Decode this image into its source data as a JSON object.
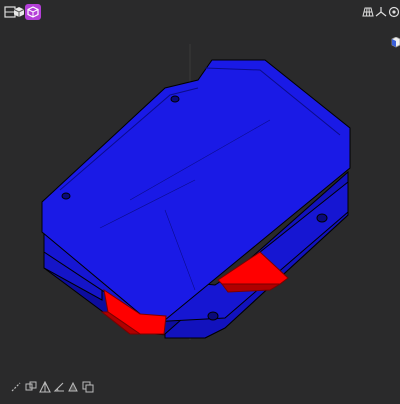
{
  "viewport": {
    "background": "#2a2a2b",
    "model": {
      "color": "#1a1ae6",
      "highlight_color": "#ff0000",
      "edge_color": "#000000"
    }
  },
  "toolbar_top_left": {
    "items": [
      {
        "icon": "render-mode-icon",
        "active": false
      },
      {
        "icon": "solid-cube-icon",
        "active": false
      },
      {
        "icon": "wireframe-cube-icon",
        "active": true
      }
    ],
    "active_color": "#b43fd8"
  },
  "toolbar_top_right": {
    "items": [
      {
        "icon": "grid-floor-icon"
      },
      {
        "icon": "axes-icon"
      },
      {
        "icon": "view-eye-icon"
      }
    ]
  },
  "nav_cube": {
    "icon": "nav-cube-icon"
  },
  "toolbar_bottom": {
    "items": [
      {
        "icon": "measure-distance-icon"
      },
      {
        "icon": "edge-select-icon"
      },
      {
        "icon": "face-select-icon"
      },
      {
        "icon": "angle-measure-icon"
      },
      {
        "icon": "area-measure-icon"
      },
      {
        "icon": "clear-measure-icon"
      }
    ]
  }
}
